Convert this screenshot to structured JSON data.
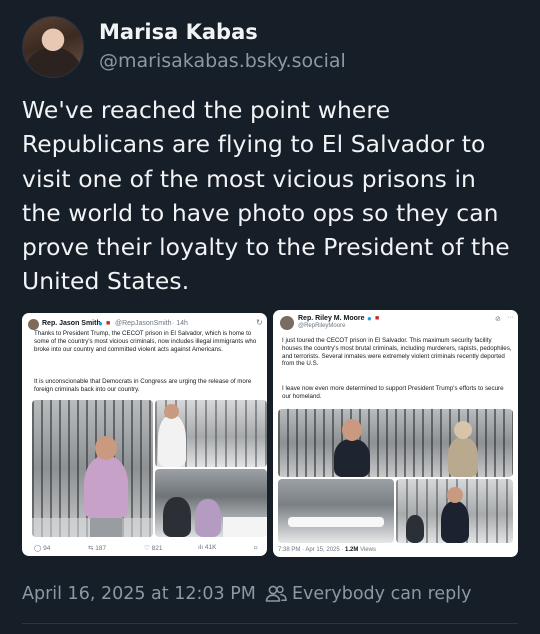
{
  "author": {
    "display_name": "Marisa Kabas",
    "handle": "@marisakabas.bsky.social"
  },
  "post": {
    "text": "We've reached the point where Republicans are flying to El Salvador to visit one of the most vicious prisons in the world to have photo ops so they can prove their loyalty to the President of the United States.",
    "timestamp": "April 16, 2025 at 12:03 PM",
    "reply_setting": "Everybody can reply"
  },
  "embeds": [
    {
      "name": "Rep. Jason Smith",
      "handle": "@RepJasonSmith",
      "time": "· 14h",
      "text1": "Thanks to President Trump, the CECOT prison in El Salvador, which is home to some of the country's most vicious criminals, now includes illegal immigrants who broke into our country and committed violent acts against Americans.",
      "text2": "It is unconscionable that Democrats in Congress are urging the release of more foreign criminals back into our country.",
      "actions": {
        "replies": "94",
        "reposts": "187",
        "likes": "821",
        "views": "41K"
      }
    },
    {
      "name": "Rep. Riley M. Moore",
      "handle": "@RepRileyMoore",
      "text1": "I just toured the CECOT prison in El Salvador. This maximum security facility houses the country's most brutal criminals, including murderers, rapists, pedophiles, and terrorists. Several inmates were extremely violent criminals recently deported from the U.S.",
      "text2": "I leave now even more determined to support President Trump's efforts to secure our homeland.",
      "meta": "7:38 PM · Apr 15, 2025 ·",
      "views_count": "1.2M",
      "views_label": "Views"
    }
  ],
  "colors": {
    "background": "#161e27",
    "text_primary": "#f1f3f5",
    "text_secondary": "#8b98a5",
    "verified_blue": "#1d9bf0"
  },
  "icons": {
    "reply_setting": "people-icon"
  }
}
